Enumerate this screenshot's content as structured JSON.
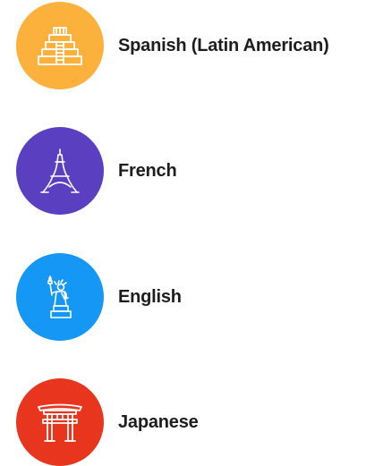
{
  "languages": [
    {
      "label": "Spanish (Latin American)",
      "icon": "pyramid-icon",
      "color": "#FBB13C"
    },
    {
      "label": "French",
      "icon": "eiffel-tower-icon",
      "color": "#5A3FC0"
    },
    {
      "label": "English",
      "icon": "statue-of-liberty-icon",
      "color": "#1497F5"
    },
    {
      "label": "Japanese",
      "icon": "torii-gate-icon",
      "color": "#E8351E"
    }
  ]
}
